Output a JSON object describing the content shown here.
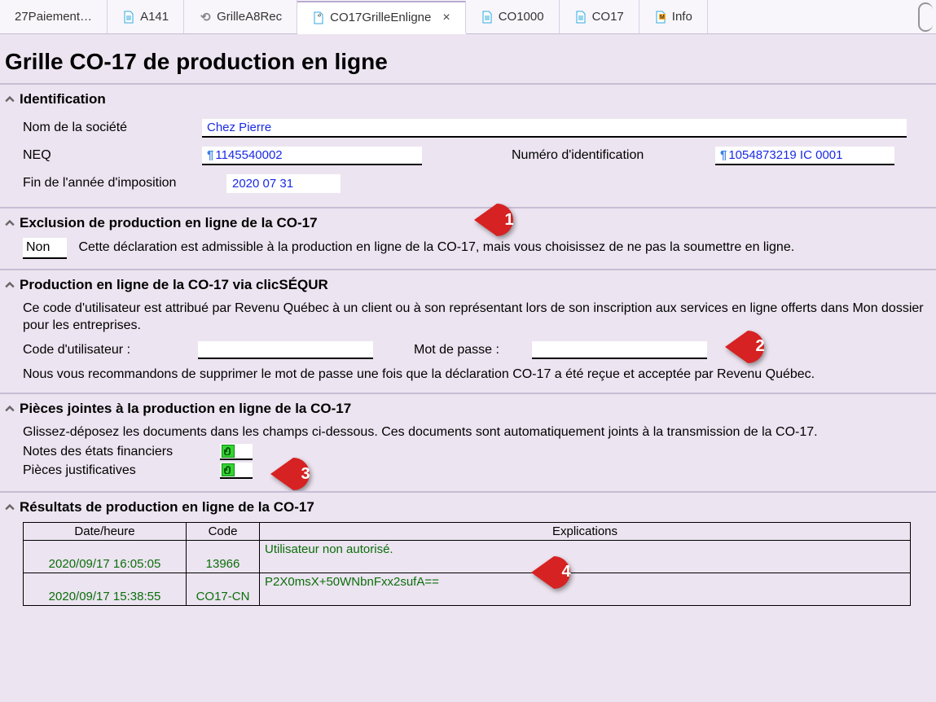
{
  "tabs": [
    {
      "label": "27Paiement…",
      "icon": "none"
    },
    {
      "label": "A141",
      "icon": "doc-blue"
    },
    {
      "label": "GrilleA8Rec",
      "icon": "bracket"
    },
    {
      "label": "CO17GrilleEnligne",
      "icon": "doc-clip",
      "active": true,
      "closeable": true
    },
    {
      "label": "CO1000",
      "icon": "doc-blue"
    },
    {
      "label": "CO17",
      "icon": "doc-blue"
    },
    {
      "label": "Info",
      "icon": "doc-orange"
    }
  ],
  "page_title": "Grille CO-17 de production en ligne",
  "identification": {
    "title": "Identification",
    "labels": {
      "company": "Nom de la société",
      "neq": "NEQ",
      "idnum": "Numéro d'identification",
      "year_end": "Fin de l'année d'imposition"
    },
    "values": {
      "company": "Chez Pierre",
      "neq": "1145540002",
      "idnum": "1054873219 IC 0001",
      "year_end": "2020 07 31"
    }
  },
  "exclusion": {
    "title": "Exclusion de production en ligne de la CO-17",
    "value": "Non",
    "text": "Cette déclaration est admissible à la production en ligne de la CO-17, mais vous choisissez de ne pas la soumettre en ligne."
  },
  "clicsequr": {
    "title": "Production en ligne de la CO-17 via clicSÉQUR",
    "intro": "Ce code d'utilisateur est attribué par Revenu Québec à un client ou à son représentant lors de son inscription aux services en ligne offerts dans Mon dossier pour les entreprises.",
    "labels": {
      "user": "Code d'utilisateur :",
      "pass": "Mot de passe :"
    },
    "values": {
      "user": "",
      "pass": ""
    },
    "note": "Nous vous recommandons de supprimer le mot de passe une fois que la déclaration CO-17 a été reçue et acceptée par Revenu Québec."
  },
  "attachments": {
    "title": "Pièces jointes à la production en ligne de la CO-17",
    "intro": "Glissez-déposez les documents dans les champs ci-dessous. Ces documents sont automatiquement joints à la transmission de la CO-17.",
    "labels": {
      "notes": "Notes des états financiers",
      "justif": "Pièces justificatives"
    }
  },
  "results": {
    "title": "Résultats de production en ligne de la CO-17",
    "headers": {
      "datetime": "Date/heure",
      "code": "Code",
      "expl": "Explications"
    },
    "rows": [
      {
        "datetime": "2020/09/17 16:05:05",
        "code": "13966",
        "expl": "Utilisateur non autorisé."
      },
      {
        "datetime": "2020/09/17 15:38:55",
        "code": "CO17-CN",
        "expl": "P2X0msX+50WNbnFxx2sufA=="
      }
    ]
  },
  "callouts": {
    "c1": "1",
    "c2": "2",
    "c3": "3",
    "c4": "4"
  }
}
